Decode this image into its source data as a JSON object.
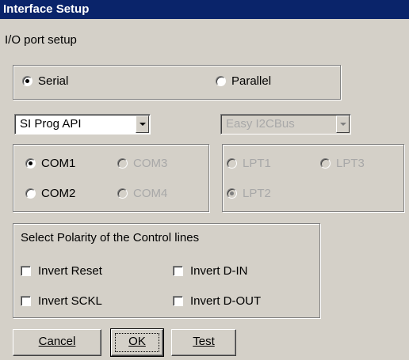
{
  "window": {
    "title": "Interface Setup"
  },
  "io_section": {
    "label": "I/O port setup"
  },
  "port_type": {
    "serial_label": "Serial",
    "parallel_label": "Parallel",
    "selected": "Serial"
  },
  "serial_api": {
    "selected": "SI Prog API"
  },
  "parallel_api": {
    "selected": "Easy I2CBus"
  },
  "com_ports": {
    "com1": "COM1",
    "com2": "COM2",
    "com3": "COM3",
    "com4": "COM4",
    "selected": "COM1"
  },
  "lpt_ports": {
    "lpt1": "LPT1",
    "lpt2": "LPT2",
    "lpt3": "LPT3",
    "selected": "LPT2"
  },
  "polarity": {
    "title": "Select Polarity of the Control lines",
    "invert_reset": "Invert Reset",
    "invert_sckl": "Invert SCKL",
    "invert_din": "Invert D-IN",
    "invert_dout": "Invert D-OUT"
  },
  "buttons": {
    "cancel": "Cancel",
    "ok": "OK",
    "test": "Test"
  }
}
